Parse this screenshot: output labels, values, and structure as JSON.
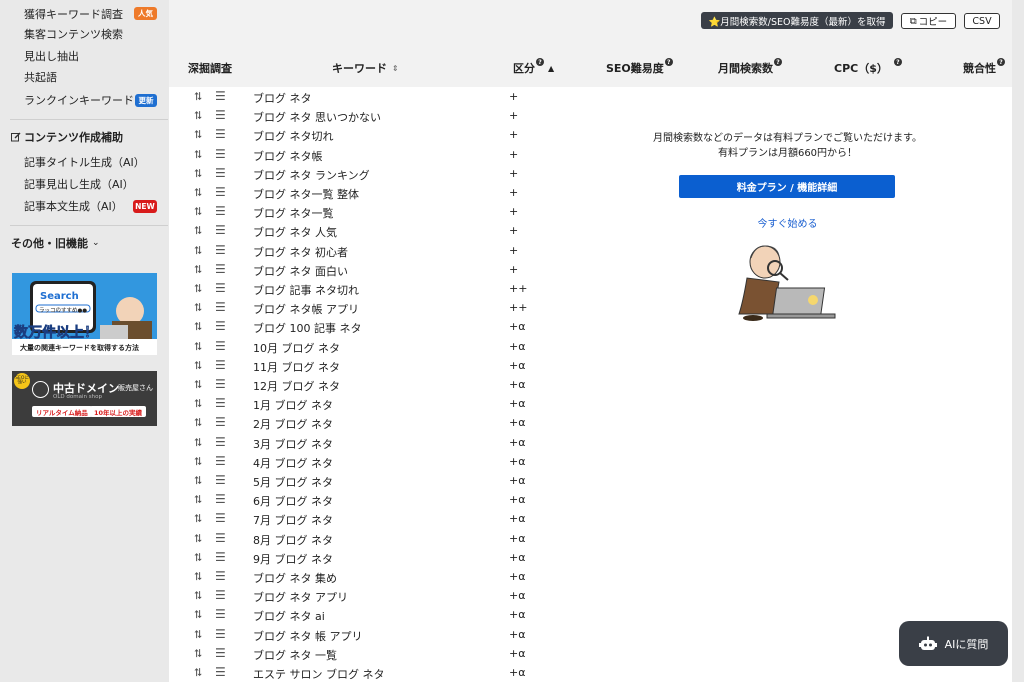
{
  "sidebar": {
    "items_top": [
      {
        "label": "獲得キーワード調査",
        "badge": "人気",
        "badge_color": "orange"
      },
      {
        "label": "集客コンテンツ検索"
      },
      {
        "label": "見出し抽出"
      },
      {
        "label": "共起語"
      },
      {
        "label": "ランクインキーワード",
        "badge": "更新",
        "badge_color": "blue"
      }
    ],
    "section_heading": "コンテンツ作成補助",
    "items_content": [
      {
        "label": "記事タイトル生成（AI）"
      },
      {
        "label": "記事見出し生成（AI）"
      },
      {
        "label": "記事本文生成（AI）",
        "badge": "NEW",
        "badge_color": "red"
      }
    ],
    "other_heading": "その他・旧機能",
    "banner1": {
      "search": "Search",
      "query": "ラッコのすすめ●●",
      "headline": "数万件以上！",
      "caption": "大量の関連キーワードを取得する方法"
    },
    "banner2": {
      "tag": "SEOに強い",
      "title": "中古ドメイン",
      "suffix": "販売屋さん",
      "subtitle": "OLD domain shop",
      "pill1": "リアルタイム納品",
      "pill2": "10年以上の実績"
    }
  },
  "toolbar": {
    "fetch_label": "⭐月間検索数/SEO難易度（最新）を取得",
    "copy_label": "コピー",
    "csv_label": "CSV"
  },
  "table": {
    "headers": {
      "drill": "深掘調査",
      "keyword": "キーワード",
      "category": "区分",
      "seo": "SEO難易度",
      "monthly": "月間検索数",
      "cpc": "CPC（$）",
      "competition": "競合性"
    },
    "rows": [
      {
        "keyword": "ブログ ネタ",
        "category": "+"
      },
      {
        "keyword": "ブログ ネタ 思いつかない",
        "category": "+"
      },
      {
        "keyword": "ブログ ネタ切れ",
        "category": "+"
      },
      {
        "keyword": "ブログ ネタ帳",
        "category": "+"
      },
      {
        "keyword": "ブログ ネタ ランキング",
        "category": "+"
      },
      {
        "keyword": "ブログ ネタ一覧 整体",
        "category": "+"
      },
      {
        "keyword": "ブログ ネタ一覧",
        "category": "+"
      },
      {
        "keyword": "ブログ ネタ 人気",
        "category": "+"
      },
      {
        "keyword": "ブログ ネタ 初心者",
        "category": "+"
      },
      {
        "keyword": "ブログ ネタ 面白い",
        "category": "+"
      },
      {
        "keyword": "ブログ 記事 ネタ切れ",
        "category": "++"
      },
      {
        "keyword": "ブログ ネタ帳 アプリ",
        "category": "++"
      },
      {
        "keyword": "ブログ 100 記事 ネタ",
        "category": "+α"
      },
      {
        "keyword": "10月 ブログ ネタ",
        "category": "+α"
      },
      {
        "keyword": "11月 ブログ ネタ",
        "category": "+α"
      },
      {
        "keyword": "12月 ブログ ネタ",
        "category": "+α"
      },
      {
        "keyword": "1月 ブログ ネタ",
        "category": "+α"
      },
      {
        "keyword": "2月 ブログ ネタ",
        "category": "+α"
      },
      {
        "keyword": "3月 ブログ ネタ",
        "category": "+α"
      },
      {
        "keyword": "4月 ブログ ネタ",
        "category": "+α"
      },
      {
        "keyword": "5月 ブログ ネタ",
        "category": "+α"
      },
      {
        "keyword": "6月 ブログ ネタ",
        "category": "+α"
      },
      {
        "keyword": "7月 ブログ ネタ",
        "category": "+α"
      },
      {
        "keyword": "8月 ブログ ネタ",
        "category": "+α"
      },
      {
        "keyword": "9月 ブログ ネタ",
        "category": "+α"
      },
      {
        "keyword": "ブログ ネタ 集め",
        "category": "+α"
      },
      {
        "keyword": "ブログ ネタ アプリ",
        "category": "+α"
      },
      {
        "keyword": "ブログ ネタ ai",
        "category": "+α"
      },
      {
        "keyword": "ブログ ネタ 帳 アプリ",
        "category": "+α"
      },
      {
        "keyword": "ブログ ネタ 一覧",
        "category": "+α"
      },
      {
        "keyword": "エステ サロン ブログ ネタ",
        "category": "+α"
      }
    ]
  },
  "paywall": {
    "line1": "月間検索数などのデータは有料プランでご覧いただけます。",
    "line2": "有料プランは月額660円から！",
    "plan_button": "料金プラン / 機能詳細",
    "start_link": "今すぐ始める"
  },
  "ai_button": {
    "label": "AIに質問"
  },
  "colors": {
    "accent": "#0b5fd0",
    "dark": "#3a3f47",
    "orange": "#ee7a2a",
    "blue": "#1f6fd1",
    "red": "#d81b1b"
  }
}
